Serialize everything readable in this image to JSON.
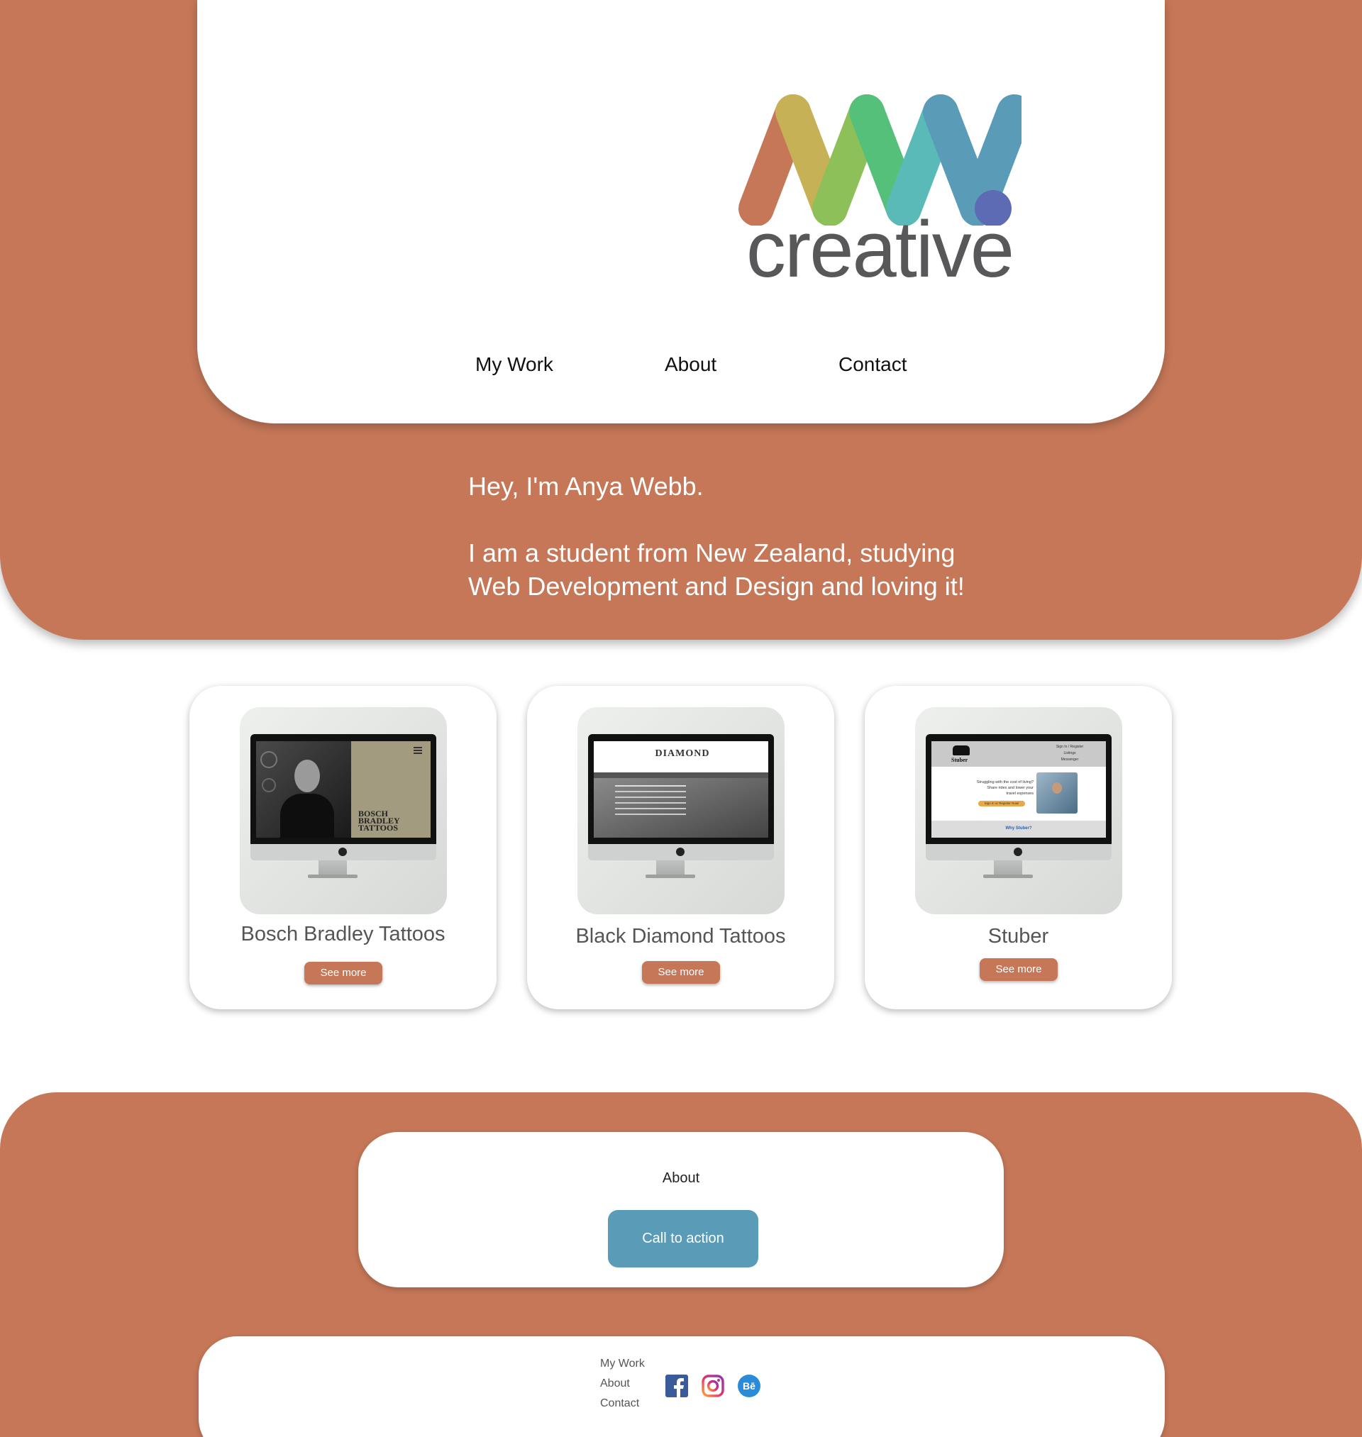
{
  "header": {
    "logo_text": "creative",
    "nav": [
      "My Work",
      "About",
      "Contact"
    ]
  },
  "intro": {
    "greeting": "Hey, I'm Anya Webb.",
    "line1": "I am a student from New Zealand, studying",
    "line2": "Web Development and Design and loving it!"
  },
  "projects": [
    {
      "title": "Bosch Bradley Tattoos",
      "button": "See more",
      "screen_text": [
        "BOSCH",
        "BRADLEY",
        "TATTOOS"
      ]
    },
    {
      "title": "Black Diamond Tattoos",
      "button": "See more",
      "screen_text": "DIAMOND"
    },
    {
      "title": "Stuber",
      "button": "See more",
      "screen_text": {
        "brand": "Stuber",
        "links": [
          "Sign In / Register",
          "Listings",
          "Messenger"
        ],
        "tagline": [
          "Struggling with the cost of living?",
          "Share rides and lower your",
          "travel expenses"
        ],
        "cta": "Sign In or Register Now!",
        "sub": "Why Stuber?"
      }
    }
  ],
  "about": {
    "title": "About",
    "cta": "Call to action"
  },
  "footer": {
    "links": [
      "My Work",
      "About",
      "Contact"
    ],
    "social_icons": [
      "facebook-icon",
      "instagram-icon",
      "behance-icon"
    ]
  },
  "colors": {
    "brand": "#c57758",
    "cta": "#5a9bb8",
    "logo_stripes": [
      "#c57758",
      "#c7b157",
      "#8ec05a",
      "#55c07a",
      "#5abab8",
      "#5a9bb8",
      "#5d6bb5"
    ]
  }
}
